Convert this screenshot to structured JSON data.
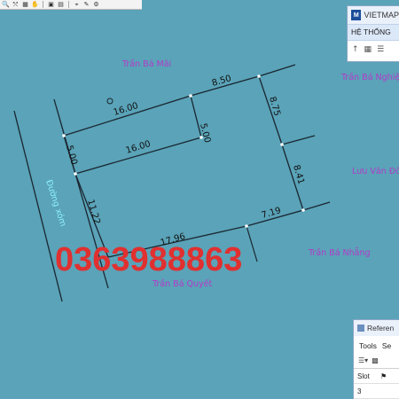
{
  "toolbar": {
    "icons": [
      "zoom-icon",
      "zoom-extent-icon",
      "select-icon",
      "pan-icon",
      "layer-icon",
      "image-icon",
      "snap-icon",
      "edit-icon",
      "settings-icon"
    ]
  },
  "vietmap_panel": {
    "title": "VIETMAP",
    "menu": "HỆ THỐNG",
    "icons": [
      "pointer-icon",
      "table-icon",
      "properties-icon"
    ]
  },
  "reference_panel": {
    "title": "Referen",
    "menu": [
      "Tools",
      "Se"
    ],
    "header": [
      "Slot"
    ],
    "rows": [
      [
        "3"
      ]
    ]
  },
  "map": {
    "neighbors": {
      "north": "Trần Bá Mãi",
      "east_top": "Trần Bá Nghiệ",
      "east_mid": "Lưu Văn Đồ",
      "south_east": "Trần Bá Nhẵng",
      "south": "Trần Bá Quyết"
    },
    "road_label": "Đường xóm",
    "dimensions": {
      "top_left": "16.00",
      "top_right": "8.50",
      "notch_height": "5.00",
      "notch_width": "16.00",
      "left_notch": "5.00",
      "east_upper": "8.75",
      "east_lower": "8.41",
      "left_side": "11.22",
      "bottom_left": "17.96",
      "bottom_right": "7.19"
    },
    "phone_overlay": "0363988863"
  },
  "colors": {
    "background": "#5AA3B8",
    "boundary": "#1a2530",
    "neighbor_text": "#b23cc8",
    "road_text": "#8ff0ff",
    "phone_text": "#e03030"
  }
}
